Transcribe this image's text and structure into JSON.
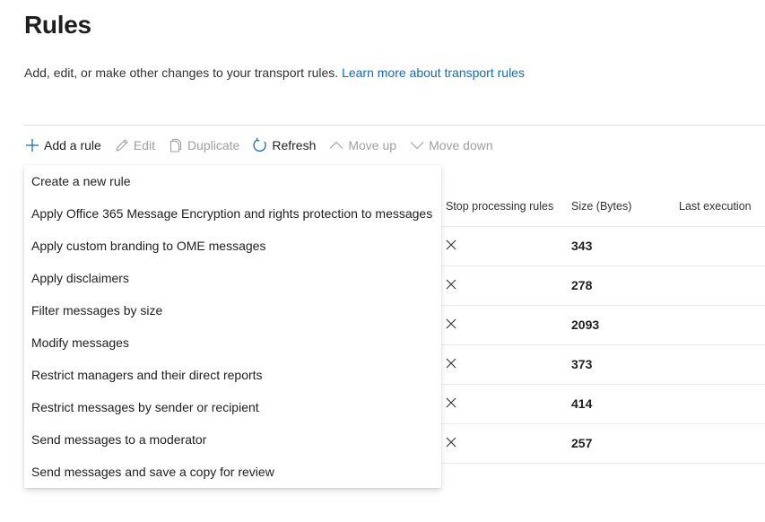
{
  "page": {
    "title": "Rules",
    "description": "Add, edit, or make other changes to your transport rules. ",
    "learn_more": "Learn more about transport rules"
  },
  "toolbar": {
    "add_rule": "Add a rule",
    "edit": "Edit",
    "duplicate": "Duplicate",
    "refresh": "Refresh",
    "move_up": "Move up",
    "move_down": "Move down"
  },
  "columns": {
    "stop_processing": "Stop processing rules",
    "size": "Size (Bytes)",
    "last_execution": "Last execution"
  },
  "rows": [
    {
      "stop": "✕",
      "size": "343"
    },
    {
      "stop": "✕",
      "size": "278"
    },
    {
      "stop": "✕",
      "size": "2093"
    },
    {
      "stop": "✕",
      "size": "373"
    },
    {
      "stop": "✕",
      "size": "414"
    },
    {
      "stop": "✕",
      "size": "257"
    }
  ],
  "menu": [
    "Create a new rule",
    "Apply Office 365 Message Encryption and rights protection to messages",
    "Apply custom branding to OME messages",
    "Apply disclaimers",
    "Filter messages by size",
    "Modify messages",
    "Restrict managers and their direct reports",
    "Restrict messages by sender or recipient",
    "Send messages to a moderator",
    "Send messages and save a copy for review"
  ],
  "colors": {
    "link": "#0f6cbd",
    "disabled_text": "#a19f9d",
    "refresh_icon": "#0f6cbd"
  },
  "icons": {
    "add_rule": "add-icon",
    "edit": "pencil-icon",
    "duplicate": "copy-icon",
    "refresh": "refresh-icon",
    "move_up": "chevron-up-icon",
    "move_down": "chevron-down-icon",
    "stop_processing": "x-icon"
  }
}
